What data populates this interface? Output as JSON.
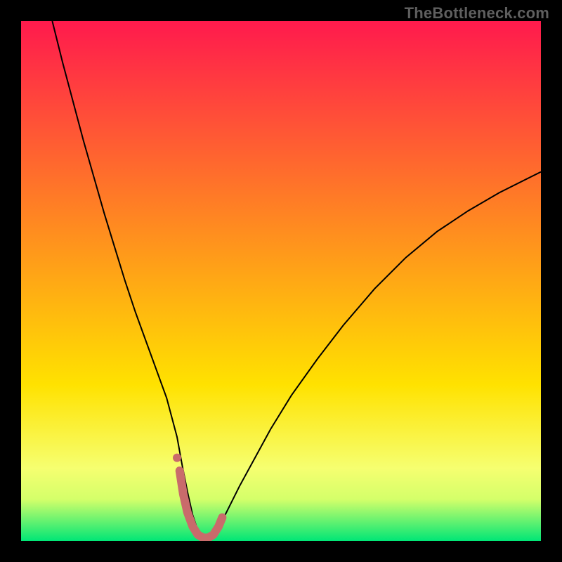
{
  "watermark": "TheBottleneck.com",
  "chart_data": {
    "type": "line",
    "title": "",
    "xlabel": "",
    "ylabel": "",
    "xlim": [
      0,
      100
    ],
    "ylim": [
      0,
      100
    ],
    "grid": false,
    "legend": false,
    "background_gradient": {
      "top_color": "#ff1a4d",
      "mid_color": "#ffe200",
      "bottom_color": "#00e676"
    },
    "series": [
      {
        "name": "main-curve",
        "stroke": "#000000",
        "stroke_width": 2,
        "x": [
          6,
          8,
          10,
          12,
          14,
          16,
          18,
          20,
          22,
          24,
          26,
          28,
          30,
          31,
          32,
          33,
          34,
          35,
          36,
          37,
          38,
          39,
          40,
          42,
          45,
          48,
          52,
          57,
          62,
          68,
          74,
          80,
          86,
          92,
          98,
          100
        ],
        "values": [
          100,
          92,
          84.5,
          77,
          70,
          63,
          56.5,
          50,
          44,
          38.5,
          33,
          27.5,
          20,
          14.5,
          9.5,
          5,
          2,
          0.5,
          0.5,
          1.5,
          3,
          4.5,
          6.5,
          10.5,
          16,
          21.5,
          28,
          35,
          41.5,
          48.5,
          54.5,
          59.5,
          63.5,
          67,
          70,
          71
        ]
      },
      {
        "name": "highlight-segment",
        "stroke": "#c96b6b",
        "stroke_width": 12,
        "linecap": "round",
        "x": [
          30.5,
          31.2,
          32,
          33,
          34,
          35,
          36,
          37,
          38,
          38.7
        ],
        "values": [
          13.5,
          9,
          5.5,
          2.8,
          1.2,
          0.6,
          0.6,
          1.2,
          2.8,
          4.5
        ]
      }
    ],
    "markers": [
      {
        "name": "highlight-dot",
        "x": 30,
        "y": 16,
        "r": 6,
        "fill": "#c96b6b"
      }
    ]
  }
}
